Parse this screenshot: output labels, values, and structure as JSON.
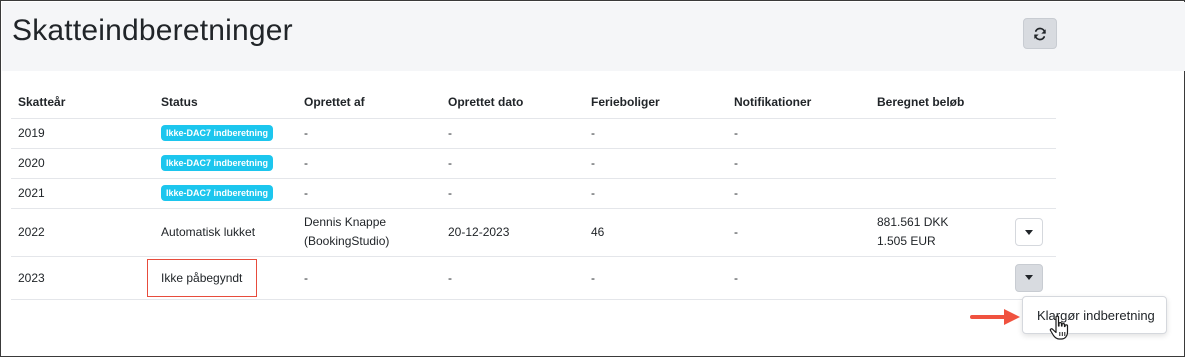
{
  "header": {
    "title": "Skatteindberetninger",
    "refresh_icon": "refresh-icon"
  },
  "table": {
    "columns": [
      "Skatteår",
      "Status",
      "Oprettet af",
      "Oprettet dato",
      "Ferieboliger",
      "Notifikationer",
      "Beregnet beløb"
    ],
    "rows": [
      {
        "year": "2019",
        "status": "Ikke-DAC7 indberetning",
        "status_type": "badge",
        "creator_line1": "-",
        "creator_line2": "",
        "date": "-",
        "houses": "-",
        "notifications": "-",
        "amount_line1": "",
        "amount_line2": ""
      },
      {
        "year": "2020",
        "status": "Ikke-DAC7 indberetning",
        "status_type": "badge",
        "creator_line1": "-",
        "creator_line2": "",
        "date": "-",
        "houses": "-",
        "notifications": "-",
        "amount_line1": "",
        "amount_line2": ""
      },
      {
        "year": "2021",
        "status": "Ikke-DAC7 indberetning",
        "status_type": "badge",
        "creator_line1": "-",
        "creator_line2": "",
        "date": "-",
        "houses": "-",
        "notifications": "-",
        "amount_line1": "",
        "amount_line2": ""
      },
      {
        "year": "2022",
        "status": "Automatisk lukket",
        "status_type": "text",
        "creator_line1": "Dennis Knappe",
        "creator_line2": "(BookingStudio)",
        "date": "20-12-2023",
        "houses": "46",
        "notifications": "-",
        "amount_line1": "881.561 DKK",
        "amount_line2": "1.505 EUR"
      },
      {
        "year": "2023",
        "status": "Ikke påbegyndt",
        "status_type": "highlighted",
        "creator_line1": "-",
        "creator_line2": "",
        "date": "-",
        "houses": "-",
        "notifications": "-",
        "amount_line1": "",
        "amount_line2": ""
      }
    ]
  },
  "dropdown": {
    "item_label": "Klargør indberetning"
  },
  "colors": {
    "header_bg": "#f5f6f8",
    "badge": "#1cc6ee",
    "highlight_border": "#e74c3c",
    "arrow": "#f0523f"
  }
}
